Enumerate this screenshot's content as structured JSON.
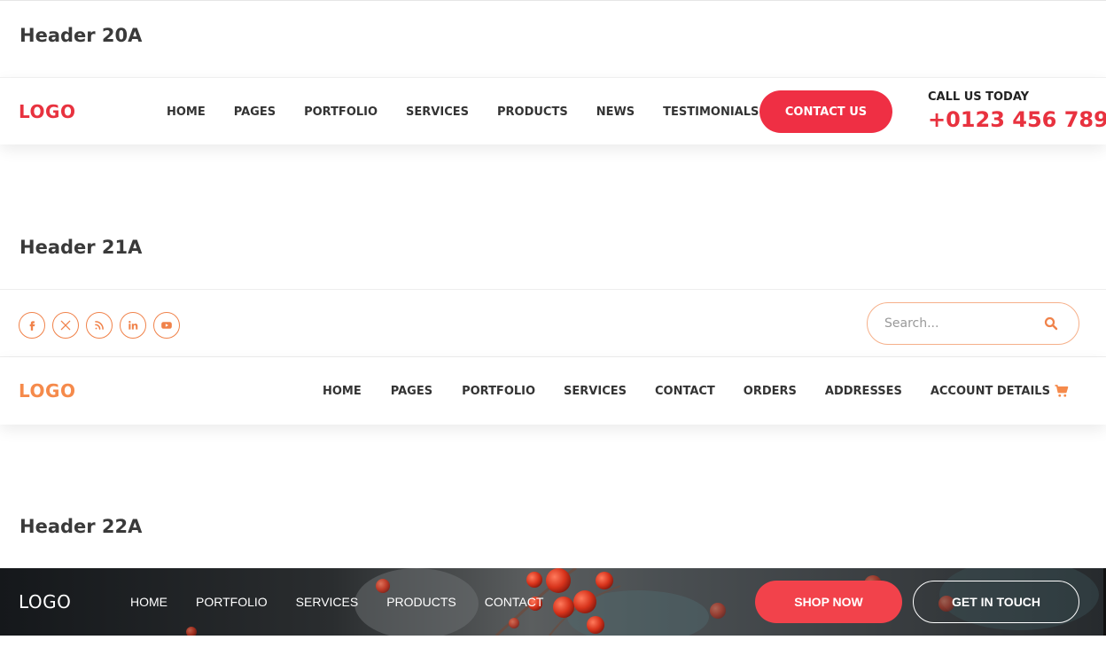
{
  "header20": {
    "section_title": "Header 20A",
    "logo": "LOGO",
    "nav": [
      "HOME",
      "PAGES",
      "PORTFOLIO",
      "SERVICES",
      "PRODUCTS",
      "NEWS",
      "TESTIMONIALS"
    ],
    "contact_button": "CONTACT US",
    "cta_label": "CALL US TODAY",
    "cta_phone": "+0123 456 789",
    "accent_color": "#e8323f"
  },
  "header21": {
    "section_title": "Header 21A",
    "social_icons": [
      "facebook-icon",
      "x-twitter-icon",
      "rss-icon",
      "linkedin-icon",
      "youtube-icon"
    ],
    "search_placeholder": "Search...",
    "logo": "LOGO",
    "nav": [
      "HOME",
      "PAGES",
      "PORTFOLIO",
      "SERVICES",
      "CONTACT",
      "ORDERS",
      "ADDRESSES",
      "ACCOUNT DETAILS"
    ],
    "cart_icon": "shopping-cart-icon",
    "accent_color": "#f58a4b"
  },
  "header22": {
    "section_title": "Header 22A",
    "logo": "LOGO",
    "nav": [
      "HOME",
      "PORTFOLIO",
      "SERVICES",
      "PRODUCTS",
      "CONTACT"
    ],
    "shop_button": "SHOP NOW",
    "touch_button": "GET IN TOUCH",
    "accent_color": "#f2424b"
  }
}
